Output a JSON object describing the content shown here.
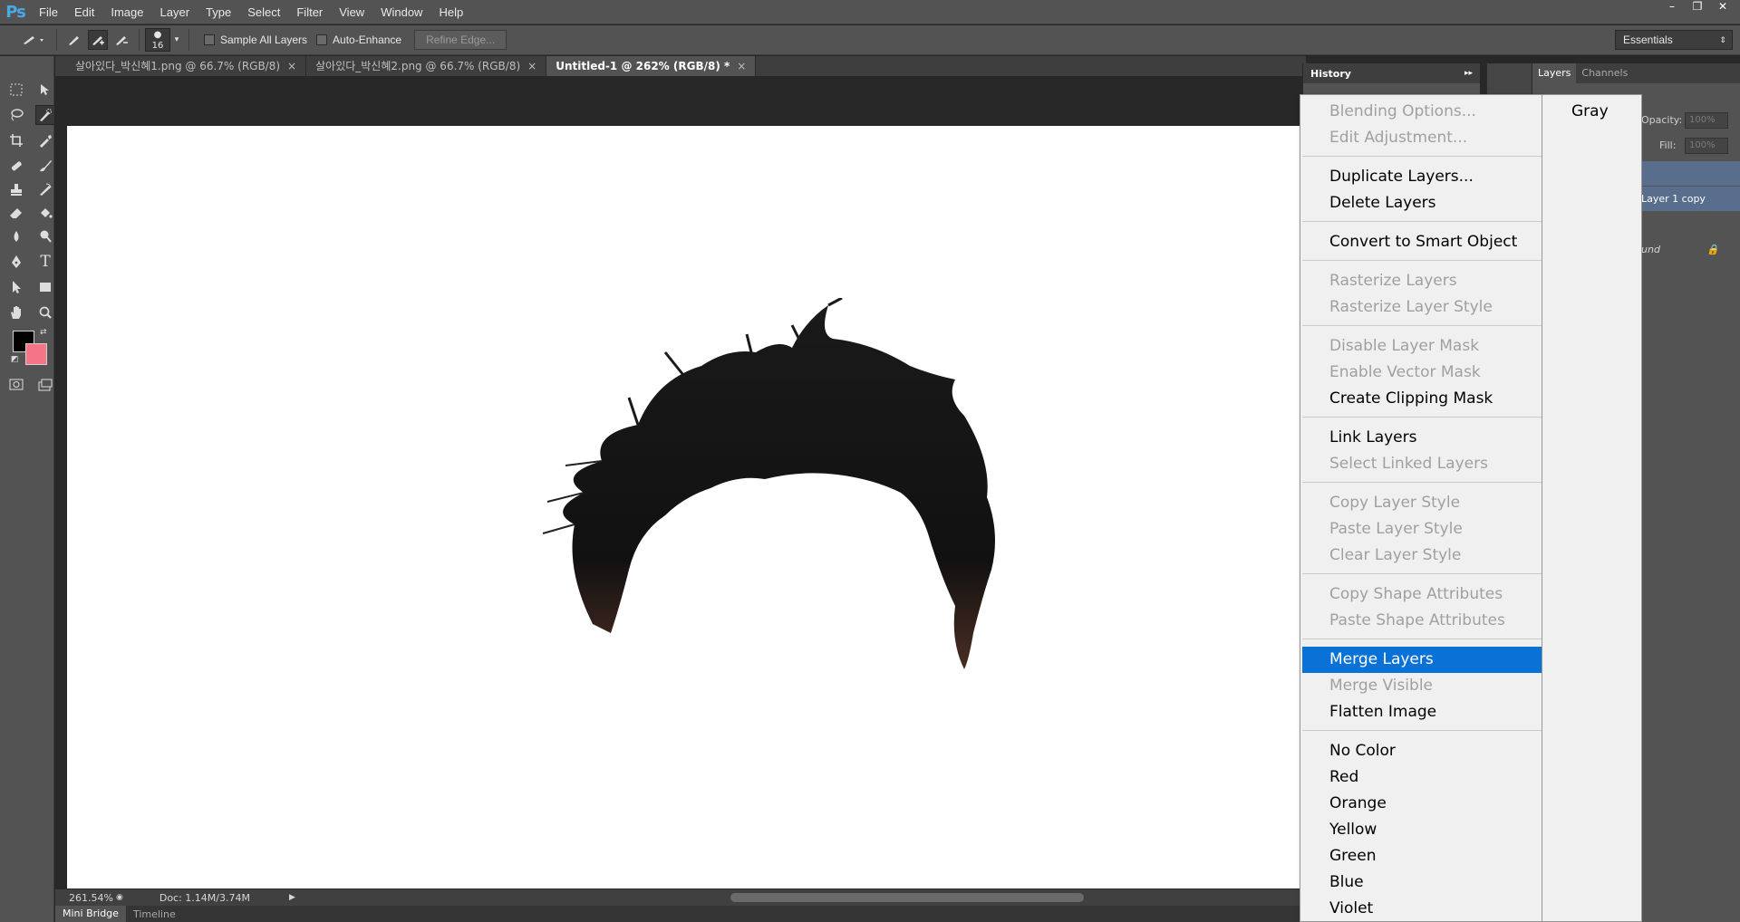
{
  "app": {
    "logo": "Ps"
  },
  "menubar": {
    "items": [
      "File",
      "Edit",
      "Image",
      "Layer",
      "Type",
      "Select",
      "Filter",
      "View",
      "Window",
      "Help"
    ]
  },
  "window_controls": {
    "minimize": "–",
    "restore": "❐",
    "close": "✕"
  },
  "options": {
    "brush_size": "16",
    "sample_all_layers": "Sample All Layers",
    "auto_enhance": "Auto-Enhance",
    "refine_edge": "Refine Edge...",
    "workspace": "Essentials"
  },
  "doc_tabs": [
    {
      "label": "살아있다_박신혜1.png @ 66.7% (RGB/8)",
      "close": "×"
    },
    {
      "label": "살아있다_박신혜2.png @ 66.7% (RGB/8)",
      "close": "×"
    },
    {
      "label": "Untitled-1 @ 262% (RGB/8) *",
      "close": "×"
    }
  ],
  "status": {
    "zoom": "261.54%",
    "doc": "Doc: 1.14M/3.74M"
  },
  "bottom_tabs": [
    "Mini Bridge",
    "Timeline"
  ],
  "panels": {
    "history_title": "History",
    "layers_tab": "Layers",
    "channels_tab": "Channels",
    "opacity_label": "Opacity:",
    "opacity_value": "100%",
    "fill_label": "Fill:",
    "fill_value": "100%",
    "layer_copy_name": "Layer 1 copy",
    "background_name": "und"
  },
  "context_menu": {
    "items": [
      {
        "label": "Blending Options...",
        "disabled": true
      },
      {
        "label": "Edit Adjustment...",
        "disabled": true
      },
      {
        "label": "Duplicate Layers...",
        "disabled": false
      },
      {
        "label": "Delete Layers",
        "disabled": false
      },
      {
        "label": "Convert to Smart Object",
        "disabled": false
      },
      {
        "label": "Rasterize Layers",
        "disabled": true
      },
      {
        "label": "Rasterize Layer Style",
        "disabled": true
      },
      {
        "label": "Disable Layer Mask",
        "disabled": true
      },
      {
        "label": "Enable Vector Mask",
        "disabled": true
      },
      {
        "label": "Create Clipping Mask",
        "disabled": false
      },
      {
        "label": "Link Layers",
        "disabled": false
      },
      {
        "label": "Select Linked Layers",
        "disabled": true
      },
      {
        "label": "Copy Layer Style",
        "disabled": true
      },
      {
        "label": "Paste Layer Style",
        "disabled": true
      },
      {
        "label": "Clear Layer Style",
        "disabled": true
      },
      {
        "label": "Copy Shape Attributes",
        "disabled": true
      },
      {
        "label": "Paste Shape Attributes",
        "disabled": true
      },
      {
        "label": "Merge Layers",
        "disabled": false,
        "highlighted": true
      },
      {
        "label": "Merge Visible",
        "disabled": true
      },
      {
        "label": "Flatten Image",
        "disabled": false
      },
      {
        "label": "No Color",
        "disabled": false
      },
      {
        "label": "Red",
        "disabled": false
      },
      {
        "label": "Orange",
        "disabled": false
      },
      {
        "label": "Yellow",
        "disabled": false
      },
      {
        "label": "Green",
        "disabled": false
      },
      {
        "label": "Blue",
        "disabled": false
      },
      {
        "label": "Violet",
        "disabled": false
      }
    ],
    "overflow_item": "Gray"
  },
  "colors": {
    "foreground": "#000000",
    "background": "#f57486",
    "highlight": "#0a72d6"
  }
}
